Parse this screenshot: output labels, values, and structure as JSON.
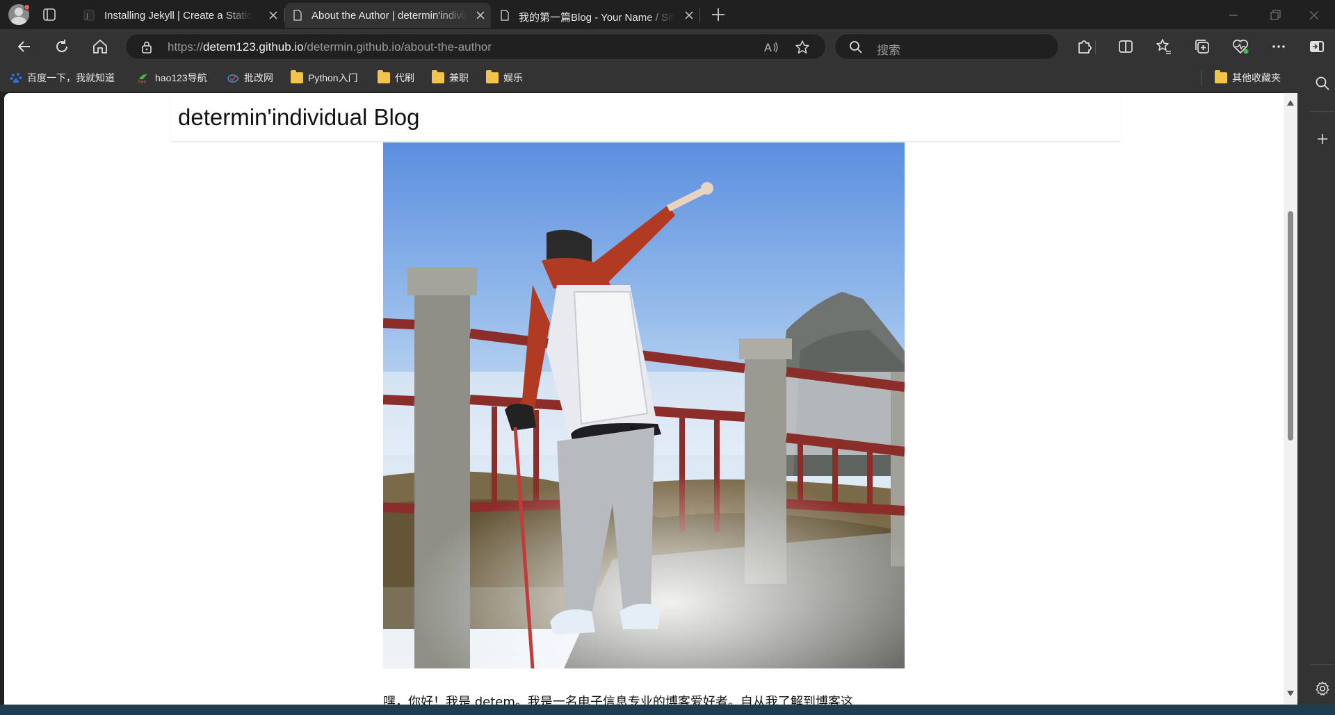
{
  "browser": {
    "tabs": [
      {
        "title": "Installing Jekyll | Create a Static W",
        "active": false
      },
      {
        "title": "About the Author | determin'individual Blog",
        "active": true
      },
      {
        "title": "我的第一篇Blog - Your Name / Site",
        "active": false
      }
    ],
    "url": {
      "scheme": "https://",
      "host": "detem123.github.io",
      "path": "/determin.github.io/about-the-author"
    },
    "search_placeholder": "搜索",
    "bookmarks": [
      {
        "label": "百度一下，我就知道",
        "icon": "baidu-icon"
      },
      {
        "label": "hao123导航",
        "icon": "hao123-icon"
      },
      {
        "label": "批改网",
        "icon": "pigai-icon"
      },
      {
        "label": "Python入门",
        "icon": "folder-icon"
      },
      {
        "label": "代刷",
        "icon": "folder-icon"
      },
      {
        "label": "兼职",
        "icon": "folder-icon"
      },
      {
        "label": "娱乐",
        "icon": "folder-icon"
      }
    ],
    "other_bookmarks": "其他收藏夹"
  },
  "page": {
    "site_title": "determin'individual Blog",
    "intro_text": "嘿，你好！我是 detem。我是一名电子信息专业的博客爱好者。自从我了解到博客这"
  },
  "colors": {
    "tab_strip": "#202020",
    "toolbar": "#333333",
    "page_bg": "#ffffff",
    "folder": "#f3c44b",
    "sky": "#5f91de"
  }
}
